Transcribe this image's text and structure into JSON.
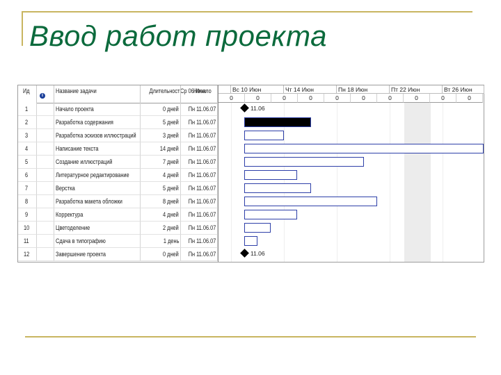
{
  "slide": {
    "title": "Ввод работ проекта"
  },
  "columns": {
    "id": "Ид",
    "indicator": "i",
    "name": "Название задачи",
    "duration": "Длительность",
    "start": "Начало",
    "start_overlap": "Ср 06 Июн"
  },
  "weeks": [
    "Вс 10 Июн",
    "Чт 14 Июн",
    "Пн 18 Июн",
    "Пт 22 Июн",
    "Вт 26 Июн"
  ],
  "days": [
    "0",
    "0",
    "0",
    "0",
    "0",
    "0",
    "0",
    "0",
    "0",
    "0"
  ],
  "tasks": [
    {
      "id": "1",
      "name": "Начало проекта",
      "duration": "0 дней",
      "start": "Пн 11.06.07",
      "days": 0,
      "milestone": true,
      "label": "11.06"
    },
    {
      "id": "2",
      "name": "Разработка содержания",
      "duration": "5 дней",
      "start": "Пн 11.06.07",
      "days": 5,
      "filled": true
    },
    {
      "id": "3",
      "name": "Разработка эскизов иллюстраций",
      "duration": "3 дней",
      "start": "Пн 11.06.07",
      "days": 3
    },
    {
      "id": "4",
      "name": "Написание текста",
      "duration": "14 дней",
      "start": "Пн 11.06.07",
      "days": 18
    },
    {
      "id": "5",
      "name": "Создание иллюстраций",
      "duration": "7 дней",
      "start": "Пн 11.06.07",
      "days": 9
    },
    {
      "id": "6",
      "name": "Литературное редактирование",
      "duration": "4 дней",
      "start": "Пн 11.06.07",
      "days": 4
    },
    {
      "id": "7",
      "name": "Верстка",
      "duration": "5 дней",
      "start": "Пн 11.06.07",
      "days": 5
    },
    {
      "id": "8",
      "name": "Разработка макета обложки",
      "duration": "8 дней",
      "start": "Пн 11.06.07",
      "days": 10
    },
    {
      "id": "9",
      "name": "Корректура",
      "duration": "4 дней",
      "start": "Пн 11.06.07",
      "days": 4
    },
    {
      "id": "10",
      "name": "Цветоделение",
      "duration": "2 дней",
      "start": "Пн 11.06.07",
      "days": 2
    },
    {
      "id": "11",
      "name": "Сдача в типографию",
      "duration": "1 день",
      "start": "Пн 11.06.07",
      "days": 1
    },
    {
      "id": "12",
      "name": "Завершение проекта",
      "duration": "0 дней",
      "start": "Пн 11.06.07",
      "days": 0,
      "milestone": true,
      "label": "11.06"
    }
  ],
  "colors": {
    "title": "#0b6a3c",
    "rule": "#c8b560",
    "bar_border": "#2d3fa8"
  }
}
